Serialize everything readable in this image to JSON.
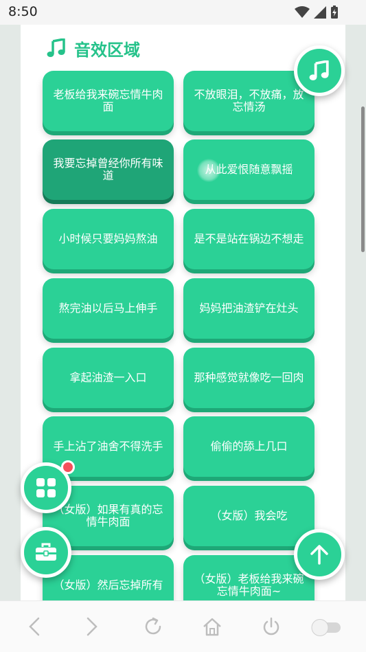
{
  "status": {
    "time": "8:50"
  },
  "section": {
    "title": "音效区域",
    "icon": "music-note-icon"
  },
  "sounds": [
    "老板给我来碗忘情牛肉面",
    "不放眼泪，不放痛，放忘情汤",
    "我要忘掉曾经你所有味道",
    "从此爱恨随意飘摇",
    "小时候只要妈妈熬油",
    "是不是站在锅边不想走",
    "熬完油以后马上伸手",
    "妈妈把油渣铲在灶头",
    "拿起油渣一入口",
    "那种感觉就像吃一回肉",
    "手上沾了油舍不得洗手",
    "偷偷的舔上几口",
    "（女版）如果有真的忘情牛肉面",
    "（女版）我会吃",
    "（女版）然后忘掉所有",
    "（女版）老板给我来碗忘情牛肉面~"
  ],
  "fabs": {
    "music": "music-note-icon",
    "grid": "grid-menu-icon",
    "toolbox": "toolbox-icon",
    "scroll_top": "arrow-up-icon"
  },
  "colors": {
    "accent": "#2bd196",
    "accent_dark": "#1ea877",
    "title": "#25c28a",
    "badge": "#f4505b"
  },
  "nav": [
    "back-icon",
    "forward-icon",
    "refresh-icon",
    "home-icon",
    "power-icon",
    "toggle-switch"
  ]
}
